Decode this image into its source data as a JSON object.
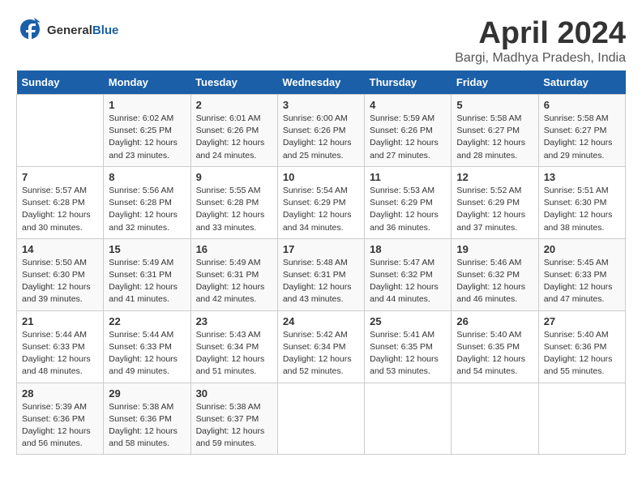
{
  "logo": {
    "general": "General",
    "blue": "Blue"
  },
  "title": "April 2024",
  "location": "Bargi, Madhya Pradesh, India",
  "days_header": [
    "Sunday",
    "Monday",
    "Tuesday",
    "Wednesday",
    "Thursday",
    "Friday",
    "Saturday"
  ],
  "weeks": [
    [
      {
        "num": "",
        "detail": ""
      },
      {
        "num": "1",
        "detail": "Sunrise: 6:02 AM\nSunset: 6:25 PM\nDaylight: 12 hours\nand 23 minutes."
      },
      {
        "num": "2",
        "detail": "Sunrise: 6:01 AM\nSunset: 6:26 PM\nDaylight: 12 hours\nand 24 minutes."
      },
      {
        "num": "3",
        "detail": "Sunrise: 6:00 AM\nSunset: 6:26 PM\nDaylight: 12 hours\nand 25 minutes."
      },
      {
        "num": "4",
        "detail": "Sunrise: 5:59 AM\nSunset: 6:26 PM\nDaylight: 12 hours\nand 27 minutes."
      },
      {
        "num": "5",
        "detail": "Sunrise: 5:58 AM\nSunset: 6:27 PM\nDaylight: 12 hours\nand 28 minutes."
      },
      {
        "num": "6",
        "detail": "Sunrise: 5:58 AM\nSunset: 6:27 PM\nDaylight: 12 hours\nand 29 minutes."
      }
    ],
    [
      {
        "num": "7",
        "detail": "Sunrise: 5:57 AM\nSunset: 6:28 PM\nDaylight: 12 hours\nand 30 minutes."
      },
      {
        "num": "8",
        "detail": "Sunrise: 5:56 AM\nSunset: 6:28 PM\nDaylight: 12 hours\nand 32 minutes."
      },
      {
        "num": "9",
        "detail": "Sunrise: 5:55 AM\nSunset: 6:28 PM\nDaylight: 12 hours\nand 33 minutes."
      },
      {
        "num": "10",
        "detail": "Sunrise: 5:54 AM\nSunset: 6:29 PM\nDaylight: 12 hours\nand 34 minutes."
      },
      {
        "num": "11",
        "detail": "Sunrise: 5:53 AM\nSunset: 6:29 PM\nDaylight: 12 hours\nand 36 minutes."
      },
      {
        "num": "12",
        "detail": "Sunrise: 5:52 AM\nSunset: 6:29 PM\nDaylight: 12 hours\nand 37 minutes."
      },
      {
        "num": "13",
        "detail": "Sunrise: 5:51 AM\nSunset: 6:30 PM\nDaylight: 12 hours\nand 38 minutes."
      }
    ],
    [
      {
        "num": "14",
        "detail": "Sunrise: 5:50 AM\nSunset: 6:30 PM\nDaylight: 12 hours\nand 39 minutes."
      },
      {
        "num": "15",
        "detail": "Sunrise: 5:49 AM\nSunset: 6:31 PM\nDaylight: 12 hours\nand 41 minutes."
      },
      {
        "num": "16",
        "detail": "Sunrise: 5:49 AM\nSunset: 6:31 PM\nDaylight: 12 hours\nand 42 minutes."
      },
      {
        "num": "17",
        "detail": "Sunrise: 5:48 AM\nSunset: 6:31 PM\nDaylight: 12 hours\nand 43 minutes."
      },
      {
        "num": "18",
        "detail": "Sunrise: 5:47 AM\nSunset: 6:32 PM\nDaylight: 12 hours\nand 44 minutes."
      },
      {
        "num": "19",
        "detail": "Sunrise: 5:46 AM\nSunset: 6:32 PM\nDaylight: 12 hours\nand 46 minutes."
      },
      {
        "num": "20",
        "detail": "Sunrise: 5:45 AM\nSunset: 6:33 PM\nDaylight: 12 hours\nand 47 minutes."
      }
    ],
    [
      {
        "num": "21",
        "detail": "Sunrise: 5:44 AM\nSunset: 6:33 PM\nDaylight: 12 hours\nand 48 minutes."
      },
      {
        "num": "22",
        "detail": "Sunrise: 5:44 AM\nSunset: 6:33 PM\nDaylight: 12 hours\nand 49 minutes."
      },
      {
        "num": "23",
        "detail": "Sunrise: 5:43 AM\nSunset: 6:34 PM\nDaylight: 12 hours\nand 51 minutes."
      },
      {
        "num": "24",
        "detail": "Sunrise: 5:42 AM\nSunset: 6:34 PM\nDaylight: 12 hours\nand 52 minutes."
      },
      {
        "num": "25",
        "detail": "Sunrise: 5:41 AM\nSunset: 6:35 PM\nDaylight: 12 hours\nand 53 minutes."
      },
      {
        "num": "26",
        "detail": "Sunrise: 5:40 AM\nSunset: 6:35 PM\nDaylight: 12 hours\nand 54 minutes."
      },
      {
        "num": "27",
        "detail": "Sunrise: 5:40 AM\nSunset: 6:36 PM\nDaylight: 12 hours\nand 55 minutes."
      }
    ],
    [
      {
        "num": "28",
        "detail": "Sunrise: 5:39 AM\nSunset: 6:36 PM\nDaylight: 12 hours\nand 56 minutes."
      },
      {
        "num": "29",
        "detail": "Sunrise: 5:38 AM\nSunset: 6:36 PM\nDaylight: 12 hours\nand 58 minutes."
      },
      {
        "num": "30",
        "detail": "Sunrise: 5:38 AM\nSunset: 6:37 PM\nDaylight: 12 hours\nand 59 minutes."
      },
      {
        "num": "",
        "detail": ""
      },
      {
        "num": "",
        "detail": ""
      },
      {
        "num": "",
        "detail": ""
      },
      {
        "num": "",
        "detail": ""
      }
    ]
  ]
}
